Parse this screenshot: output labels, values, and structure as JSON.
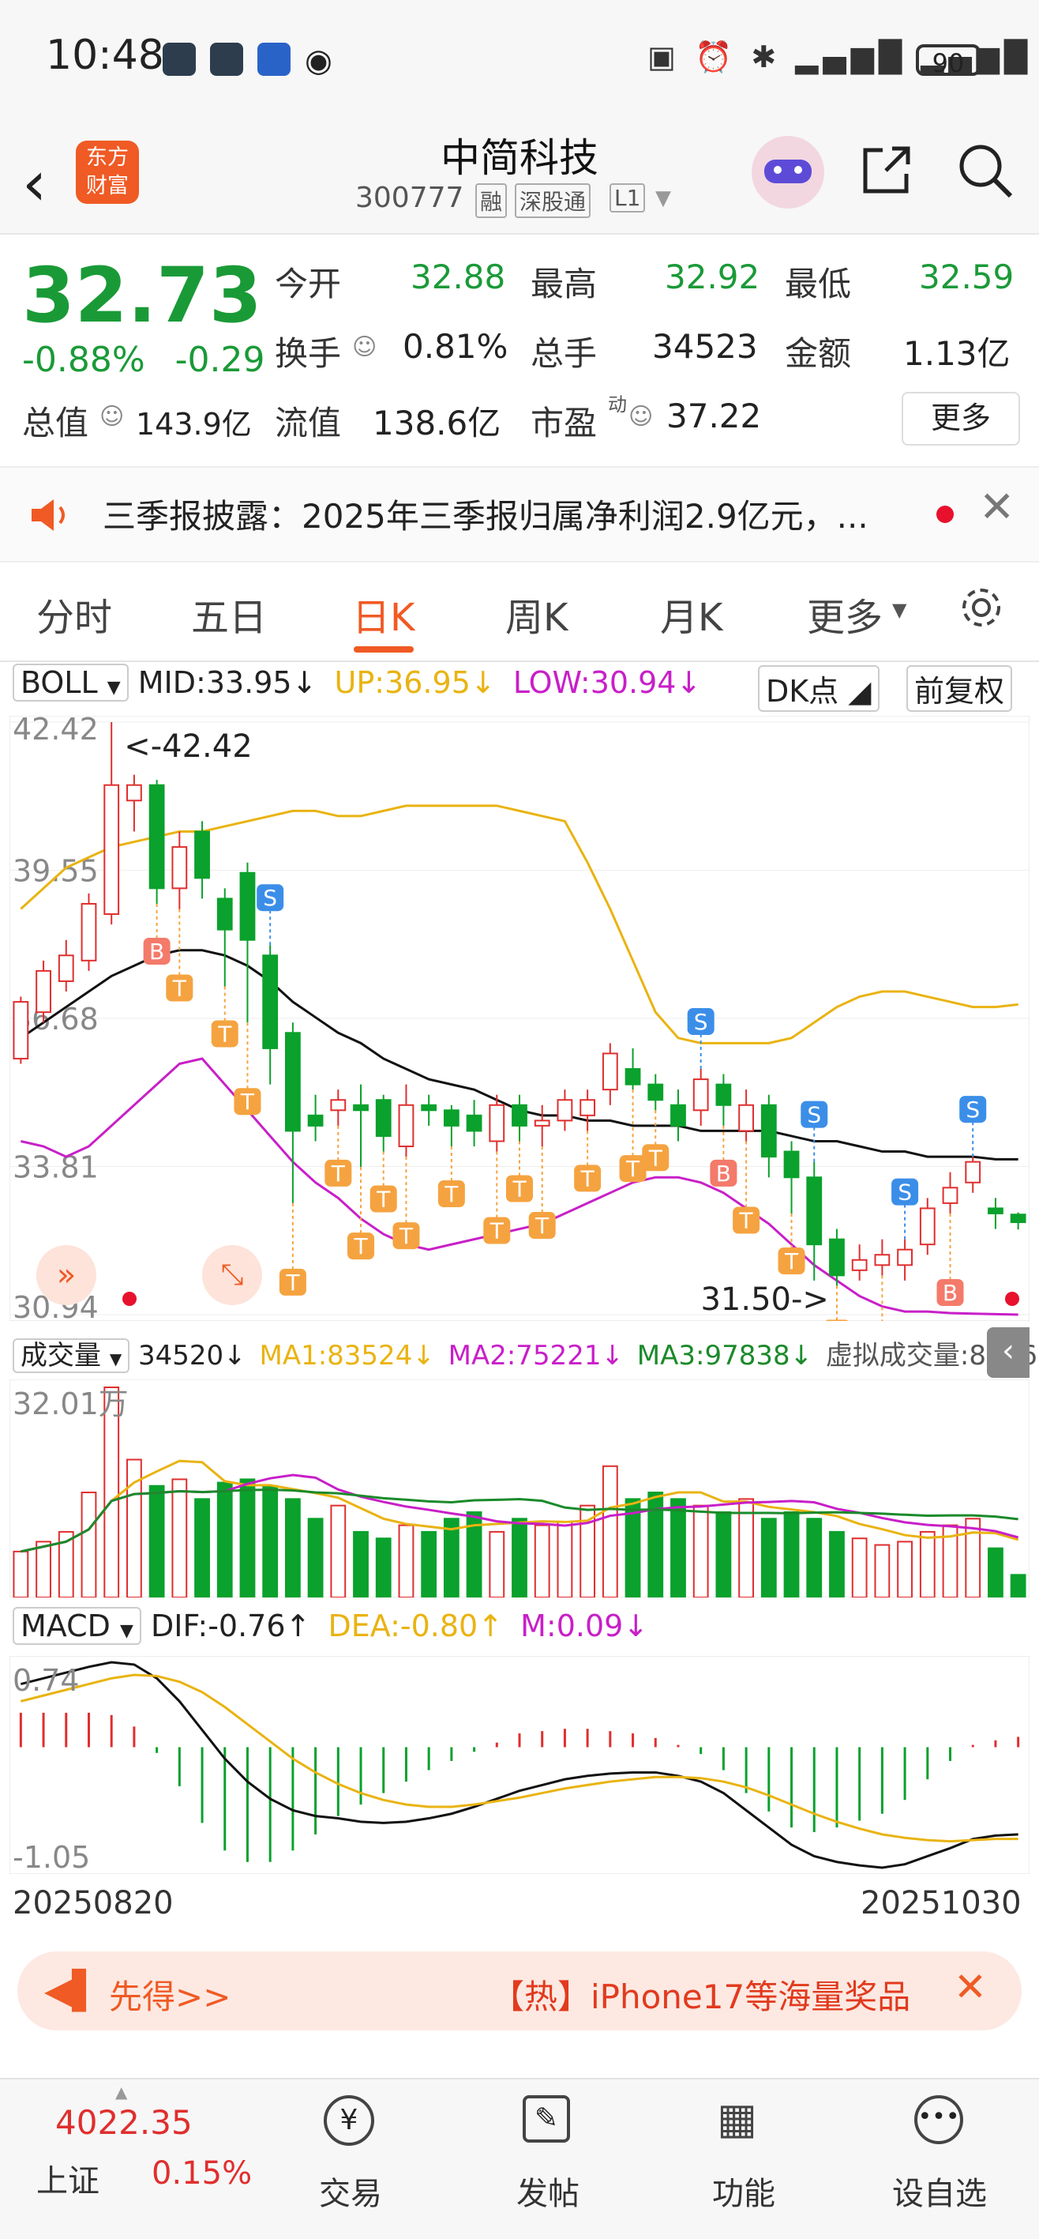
{
  "status": {
    "time": "10:48",
    "battery": "90"
  },
  "header": {
    "logo_line1": "东方",
    "logo_line2": "财富",
    "name": "中简科技",
    "code": "300777",
    "tags": [
      "融",
      "深股通",
      "L1"
    ]
  },
  "quote": {
    "price": "32.73",
    "change_pct": "-0.88%",
    "change_abs": "-0.29",
    "open_label": "今开",
    "open": "32.88",
    "high_label": "最高",
    "high": "32.92",
    "low_label": "最低",
    "low": "32.59",
    "turnover_label": "换手",
    "turnover": "0.81%",
    "volume_label": "总手",
    "volume": "34523",
    "amount_label": "金额",
    "amount": "1.13亿",
    "mktcap_label": "总值",
    "mktcap": "143.9亿",
    "float_label": "流值",
    "float": "138.6亿",
    "pe_label": "市盈",
    "pe_sup": "动",
    "pe": "37.22",
    "more": "更多"
  },
  "news": {
    "text": "三季报披露：2025年三季报归属净利润2.9亿元，..."
  },
  "tabs": [
    "分时",
    "五日",
    "日K",
    "周K",
    "月K",
    "更多"
  ],
  "active_tab": "日K",
  "boll": {
    "label": "BOLL",
    "mid": "MID:33.95↓",
    "up": "UP:36.95↓",
    "low": "LOW:30.94↓",
    "dk": "DK点",
    "fq": "前复权",
    "y_labels": [
      "42.42",
      "39.55",
      "36.68",
      "33.81",
      "30.94"
    ],
    "max_mark": "<-42.42",
    "min_mark": "31.50->"
  },
  "volume": {
    "label": "成交量",
    "value": "34520↓",
    "ma1": "MA1:83524↓",
    "ma2": "MA2:75221↓",
    "ma3": "MA3:97838↓",
    "virtual": "虚拟成交量:83461",
    "max_label": "32.01万"
  },
  "macd": {
    "label": "MACD",
    "dif": "DIF:-0.76↑",
    "dea": "DEA:-0.80↑",
    "m": "M:0.09↓",
    "top": "0.74",
    "bottom": "-1.05"
  },
  "dates": {
    "start": "20250820",
    "end": "20251030"
  },
  "promo": {
    "left": "先得>>",
    "right": "【热】iPhone17等海量奖品"
  },
  "bottom": {
    "index_value": "4022.35",
    "index_name": "上证",
    "index_pct": "0.15%",
    "nav": [
      "交易",
      "发帖",
      "功能",
      "设自选"
    ]
  },
  "colors": {
    "up": "#e02e2e",
    "down": "#0aa12c",
    "accent": "#f05a24",
    "ma_yellow": "#e9b311",
    "ma_magenta": "#c81fc8"
  },
  "chart_data": {
    "type": "candlestick",
    "x_range": [
      "20250820",
      "20251030"
    ],
    "candles": [
      {
        "o": 35.9,
        "c": 37.0,
        "h": 37.1,
        "l": 35.8
      },
      {
        "o": 36.8,
        "c": 37.6,
        "h": 37.8,
        "l": 36.6
      },
      {
        "o": 37.4,
        "c": 37.9,
        "h": 38.2,
        "l": 37.2
      },
      {
        "o": 37.8,
        "c": 38.9,
        "h": 39.1,
        "l": 37.6
      },
      {
        "o": 38.7,
        "c": 41.2,
        "h": 42.42,
        "l": 38.5
      },
      {
        "o": 40.9,
        "c": 41.2,
        "h": 41.4,
        "l": 40.3
      },
      {
        "o": 41.2,
        "c": 39.2,
        "h": 41.3,
        "l": 38.9
      },
      {
        "o": 39.2,
        "c": 40.0,
        "h": 40.3,
        "l": 38.8
      },
      {
        "o": 40.3,
        "c": 39.4,
        "h": 40.5,
        "l": 39.0
      },
      {
        "o": 39.0,
        "c": 38.4,
        "h": 39.2,
        "l": 37.3
      },
      {
        "o": 39.5,
        "c": 38.2,
        "h": 39.7,
        "l": 36.6
      },
      {
        "o": 37.9,
        "c": 36.1,
        "h": 38.1,
        "l": 35.4
      },
      {
        "o": 36.4,
        "c": 34.5,
        "h": 36.6,
        "l": 33.1
      },
      {
        "o": 34.8,
        "c": 34.6,
        "h": 35.2,
        "l": 34.3
      },
      {
        "o": 34.9,
        "c": 35.1,
        "h": 35.3,
        "l": 34.6
      },
      {
        "o": 35.0,
        "c": 34.9,
        "h": 35.4,
        "l": 33.8
      },
      {
        "o": 35.1,
        "c": 34.4,
        "h": 35.2,
        "l": 34.1
      },
      {
        "o": 34.2,
        "c": 35.0,
        "h": 35.4,
        "l": 34.0
      },
      {
        "o": 35.0,
        "c": 34.9,
        "h": 35.2,
        "l": 34.6
      },
      {
        "o": 34.9,
        "c": 34.6,
        "h": 35.0,
        "l": 34.2
      },
      {
        "o": 34.8,
        "c": 34.5,
        "h": 35.1,
        "l": 34.2
      },
      {
        "o": 34.3,
        "c": 35.0,
        "h": 35.2,
        "l": 34.1
      },
      {
        "o": 35.0,
        "c": 34.6,
        "h": 35.2,
        "l": 34.3
      },
      {
        "o": 34.6,
        "c": 34.7,
        "h": 35.0,
        "l": 34.2
      },
      {
        "o": 34.7,
        "c": 35.1,
        "h": 35.3,
        "l": 34.5
      },
      {
        "o": 34.8,
        "c": 35.1,
        "h": 35.3,
        "l": 34.5
      },
      {
        "o": 35.3,
        "c": 36.0,
        "h": 36.2,
        "l": 35.0
      },
      {
        "o": 35.7,
        "c": 35.4,
        "h": 36.1,
        "l": 35.3
      },
      {
        "o": 35.4,
        "c": 35.1,
        "h": 35.6,
        "l": 34.9
      },
      {
        "o": 35.0,
        "c": 34.6,
        "h": 35.3,
        "l": 34.3
      },
      {
        "o": 34.9,
        "c": 35.5,
        "h": 35.7,
        "l": 34.6
      },
      {
        "o": 35.4,
        "c": 35.0,
        "h": 35.6,
        "l": 34.6
      },
      {
        "o": 34.5,
        "c": 35.0,
        "h": 35.3,
        "l": 34.3
      },
      {
        "o": 35.0,
        "c": 34.0,
        "h": 35.2,
        "l": 33.6
      },
      {
        "o": 34.1,
        "c": 33.6,
        "h": 34.3,
        "l": 32.9
      },
      {
        "o": 33.6,
        "c": 32.3,
        "h": 33.9,
        "l": 31.6
      },
      {
        "o": 32.4,
        "c": 31.7,
        "h": 32.6,
        "l": 31.5
      },
      {
        "o": 31.8,
        "c": 32.0,
        "h": 32.3,
        "l": 31.6
      },
      {
        "o": 31.9,
        "c": 32.1,
        "h": 32.4,
        "l": 31.7
      },
      {
        "o": 31.9,
        "c": 32.2,
        "h": 32.4,
        "l": 31.6
      },
      {
        "o": 32.3,
        "c": 33.0,
        "h": 33.2,
        "l": 32.1
      },
      {
        "o": 33.1,
        "c": 33.4,
        "h": 33.7,
        "l": 32.9
      },
      {
        "o": 33.5,
        "c": 33.9,
        "h": 34.0,
        "l": 33.3
      },
      {
        "o": 33.0,
        "c": 32.9,
        "h": 33.2,
        "l": 32.6
      },
      {
        "o": 32.88,
        "c": 32.73,
        "h": 32.92,
        "l": 32.59
      }
    ],
    "boll_up": [
      38.8,
      39.2,
      39.6,
      39.8,
      40.0,
      40.1,
      40.2,
      40.3,
      40.3,
      40.4,
      40.5,
      40.6,
      40.7,
      40.7,
      40.6,
      40.6,
      40.7,
      40.8,
      40.8,
      40.8,
      40.8,
      40.8,
      40.7,
      40.6,
      40.5,
      39.7,
      38.8,
      37.8,
      36.8,
      36.3,
      36.2,
      36.2,
      36.2,
      36.2,
      36.3,
      36.6,
      36.9,
      37.1,
      37.2,
      37.2,
      37.1,
      37.0,
      36.9,
      36.9,
      36.95
    ],
    "boll_mid": [
      36.3,
      36.6,
      36.9,
      37.2,
      37.5,
      37.7,
      37.9,
      38.0,
      38.0,
      37.9,
      37.7,
      37.4,
      37.0,
      36.7,
      36.4,
      36.2,
      35.9,
      35.7,
      35.5,
      35.4,
      35.3,
      35.1,
      34.9,
      34.8,
      34.8,
      34.7,
      34.7,
      34.6,
      34.6,
      34.6,
      34.5,
      34.5,
      34.5,
      34.5,
      34.4,
      34.3,
      34.3,
      34.2,
      34.1,
      34.1,
      34.0,
      34.0,
      34.0,
      33.95,
      33.95
    ],
    "boll_low": [
      34.3,
      34.2,
      34.0,
      34.2,
      34.6,
      35.0,
      35.4,
      35.8,
      35.9,
      35.4,
      34.9,
      34.4,
      33.9,
      33.5,
      33.2,
      32.8,
      32.5,
      32.3,
      32.2,
      32.3,
      32.4,
      32.5,
      32.6,
      32.7,
      32.9,
      33.1,
      33.3,
      33.5,
      33.6,
      33.6,
      33.5,
      33.3,
      33.0,
      32.7,
      32.3,
      31.9,
      31.6,
      31.3,
      31.1,
      31.0,
      31.0,
      30.97,
      30.96,
      30.95,
      30.94
    ],
    "volume": [
      70000,
      85000,
      100000,
      160000,
      320100,
      210000,
      170000,
      180000,
      150000,
      175000,
      180000,
      170000,
      150000,
      120000,
      140000,
      100000,
      90000,
      110000,
      100000,
      120000,
      130000,
      100000,
      120000,
      110000,
      115000,
      140000,
      200000,
      150000,
      160000,
      150000,
      140000,
      130000,
      150000,
      120000,
      130000,
      120000,
      100000,
      90000,
      80000,
      85000,
      100000,
      110000,
      120000,
      75000,
      34520
    ],
    "macd_dif": [
      0.55,
      0.6,
      0.65,
      0.7,
      0.74,
      0.72,
      0.6,
      0.4,
      0.15,
      -0.1,
      -0.3,
      -0.45,
      -0.55,
      -0.6,
      -0.62,
      -0.65,
      -0.66,
      -0.65,
      -0.62,
      -0.58,
      -0.52,
      -0.45,
      -0.38,
      -0.33,
      -0.28,
      -0.25,
      -0.23,
      -0.22,
      -0.22,
      -0.25,
      -0.3,
      -0.4,
      -0.55,
      -0.7,
      -0.85,
      -0.95,
      -1.0,
      -1.03,
      -1.05,
      -1.02,
      -0.95,
      -0.88,
      -0.8,
      -0.77,
      -0.76
    ],
    "macd_dea": [
      0.4,
      0.45,
      0.5,
      0.55,
      0.6,
      0.63,
      0.62,
      0.57,
      0.48,
      0.35,
      0.2,
      0.05,
      -0.1,
      -0.22,
      -0.32,
      -0.4,
      -0.46,
      -0.5,
      -0.52,
      -0.52,
      -0.5,
      -0.47,
      -0.44,
      -0.4,
      -0.36,
      -0.33,
      -0.3,
      -0.28,
      -0.26,
      -0.26,
      -0.27,
      -0.3,
      -0.35,
      -0.42,
      -0.5,
      -0.58,
      -0.65,
      -0.71,
      -0.76,
      -0.79,
      -0.81,
      -0.82,
      -0.81,
      -0.8,
      -0.8
    ],
    "macd_m": [
      0.3,
      0.3,
      0.3,
      0.3,
      0.28,
      0.18,
      -0.05,
      -0.34,
      -0.66,
      -0.9,
      -1.0,
      -1.0,
      -0.9,
      -0.76,
      -0.6,
      -0.5,
      -0.4,
      -0.3,
      -0.2,
      -0.12,
      -0.04,
      0.04,
      0.12,
      0.14,
      0.16,
      0.16,
      0.14,
      0.12,
      0.08,
      0.02,
      -0.06,
      -0.2,
      -0.4,
      -0.56,
      -0.7,
      -0.74,
      -0.7,
      -0.64,
      -0.58,
      -0.46,
      -0.28,
      -0.12,
      0.02,
      0.06,
      0.09
    ],
    "signals": [
      {
        "i": 6,
        "t": "B"
      },
      {
        "i": 7,
        "t": "T"
      },
      {
        "i": 9,
        "t": "T"
      },
      {
        "i": 10,
        "t": "T"
      },
      {
        "i": 11,
        "t": "S"
      },
      {
        "i": 12,
        "t": "T"
      },
      {
        "i": 14,
        "t": "T"
      },
      {
        "i": 15,
        "t": "T"
      },
      {
        "i": 16,
        "t": "T"
      },
      {
        "i": 17,
        "t": "T"
      },
      {
        "i": 19,
        "t": "T"
      },
      {
        "i": 21,
        "t": "T"
      },
      {
        "i": 22,
        "t": "T"
      },
      {
        "i": 23,
        "t": "T"
      },
      {
        "i": 25,
        "t": "T"
      },
      {
        "i": 27,
        "t": "T"
      },
      {
        "i": 28,
        "t": "T"
      },
      {
        "i": 30,
        "t": "S"
      },
      {
        "i": 31,
        "t": "B"
      },
      {
        "i": 32,
        "t": "T"
      },
      {
        "i": 34,
        "t": "T"
      },
      {
        "i": 35,
        "t": "S"
      },
      {
        "i": 36,
        "t": "T"
      },
      {
        "i": 38,
        "t": "T"
      },
      {
        "i": 39,
        "t": "S"
      },
      {
        "i": 41,
        "t": "B"
      },
      {
        "i": 42,
        "t": "S"
      }
    ]
  }
}
